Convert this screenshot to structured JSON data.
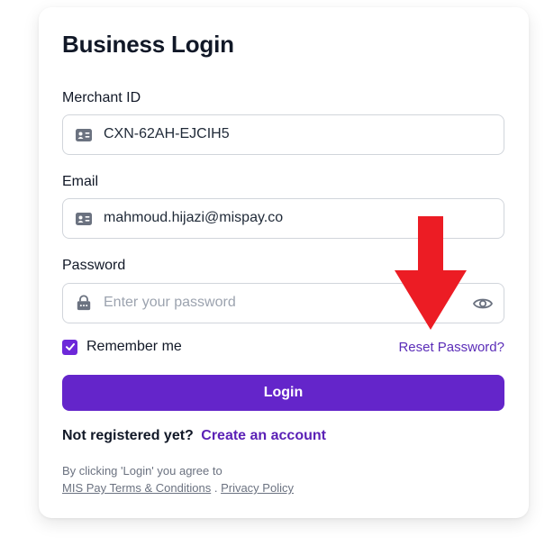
{
  "login": {
    "title": "Business Login",
    "merchant_id": {
      "label": "Merchant ID",
      "value": "CXN-62AH-EJCIH5",
      "icon": "id-card-icon"
    },
    "email": {
      "label": "Email",
      "value": "mahmoud.hijazi@mispay.co",
      "icon": "id-card-icon"
    },
    "password": {
      "label": "Password",
      "placeholder": "Enter your password",
      "icon": "lock-icon",
      "toggle_icon": "eye-icon"
    },
    "remember_label": "Remember me",
    "remember_checked": true,
    "reset_link": "Reset Password?",
    "login_button": "Login",
    "register_prompt": "Not registered yet?",
    "register_link": "Create an account",
    "terms_prefix": "By clicking 'Login' you agree to",
    "terms_link": "MIS Pay Terms & Conditions",
    "terms_separator": " . ",
    "privacy_link": "Privacy Policy"
  },
  "colors": {
    "accent": "#6425ca",
    "link": "#5b21b6",
    "annotation_arrow": "#ec1c24"
  }
}
